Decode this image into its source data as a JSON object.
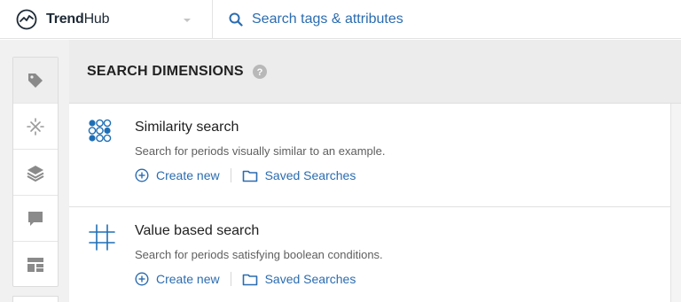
{
  "brand": {
    "name_bold": "Trend",
    "name_rest": "Hub"
  },
  "search": {
    "label": "Search tags & attributes"
  },
  "rail": {
    "items": [
      {
        "name": "tag-icon"
      },
      {
        "name": "sparkle-icon"
      },
      {
        "name": "layers-icon"
      },
      {
        "name": "comment-icon"
      },
      {
        "name": "dashboard-icon"
      }
    ]
  },
  "main": {
    "title": "SEARCH DIMENSIONS",
    "dimensions": [
      {
        "title": "Similarity search",
        "description": "Search for periods visually similar to an example.",
        "create_label": "Create new",
        "saved_label": "Saved Searches",
        "icon": "similarity-dots-icon"
      },
      {
        "title": "Value based search",
        "description": "Search for periods satisfying boolean conditions.",
        "create_label": "Create new",
        "saved_label": "Saved Searches",
        "icon": "grid-hash-icon"
      }
    ]
  },
  "colors": {
    "accent": "#2b6cb0",
    "header_bg": "#ececec",
    "rail_bg": "#f1f1f1"
  }
}
